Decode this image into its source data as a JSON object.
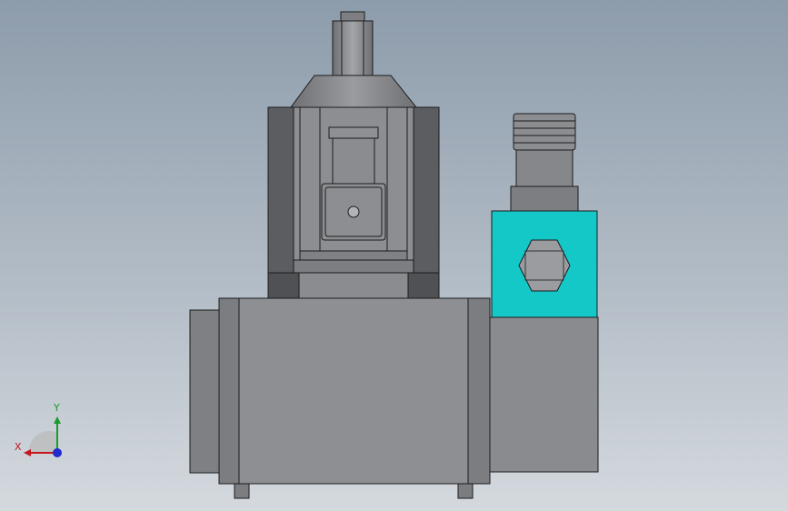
{
  "viewport": {
    "background_top": "#8d9cab",
    "background_bottom": "#d4d9de"
  },
  "model": {
    "body_color": "#8d8f93",
    "shadow_color": "#545659",
    "solenoid_color": "#14c8c8",
    "outline_color": "#1c1c1c"
  },
  "triad": {
    "x_label": "X",
    "y_label": "Y",
    "x_color": "#c4161c",
    "y_color": "#1a9a2a",
    "z_color": "#1f2bd0"
  }
}
